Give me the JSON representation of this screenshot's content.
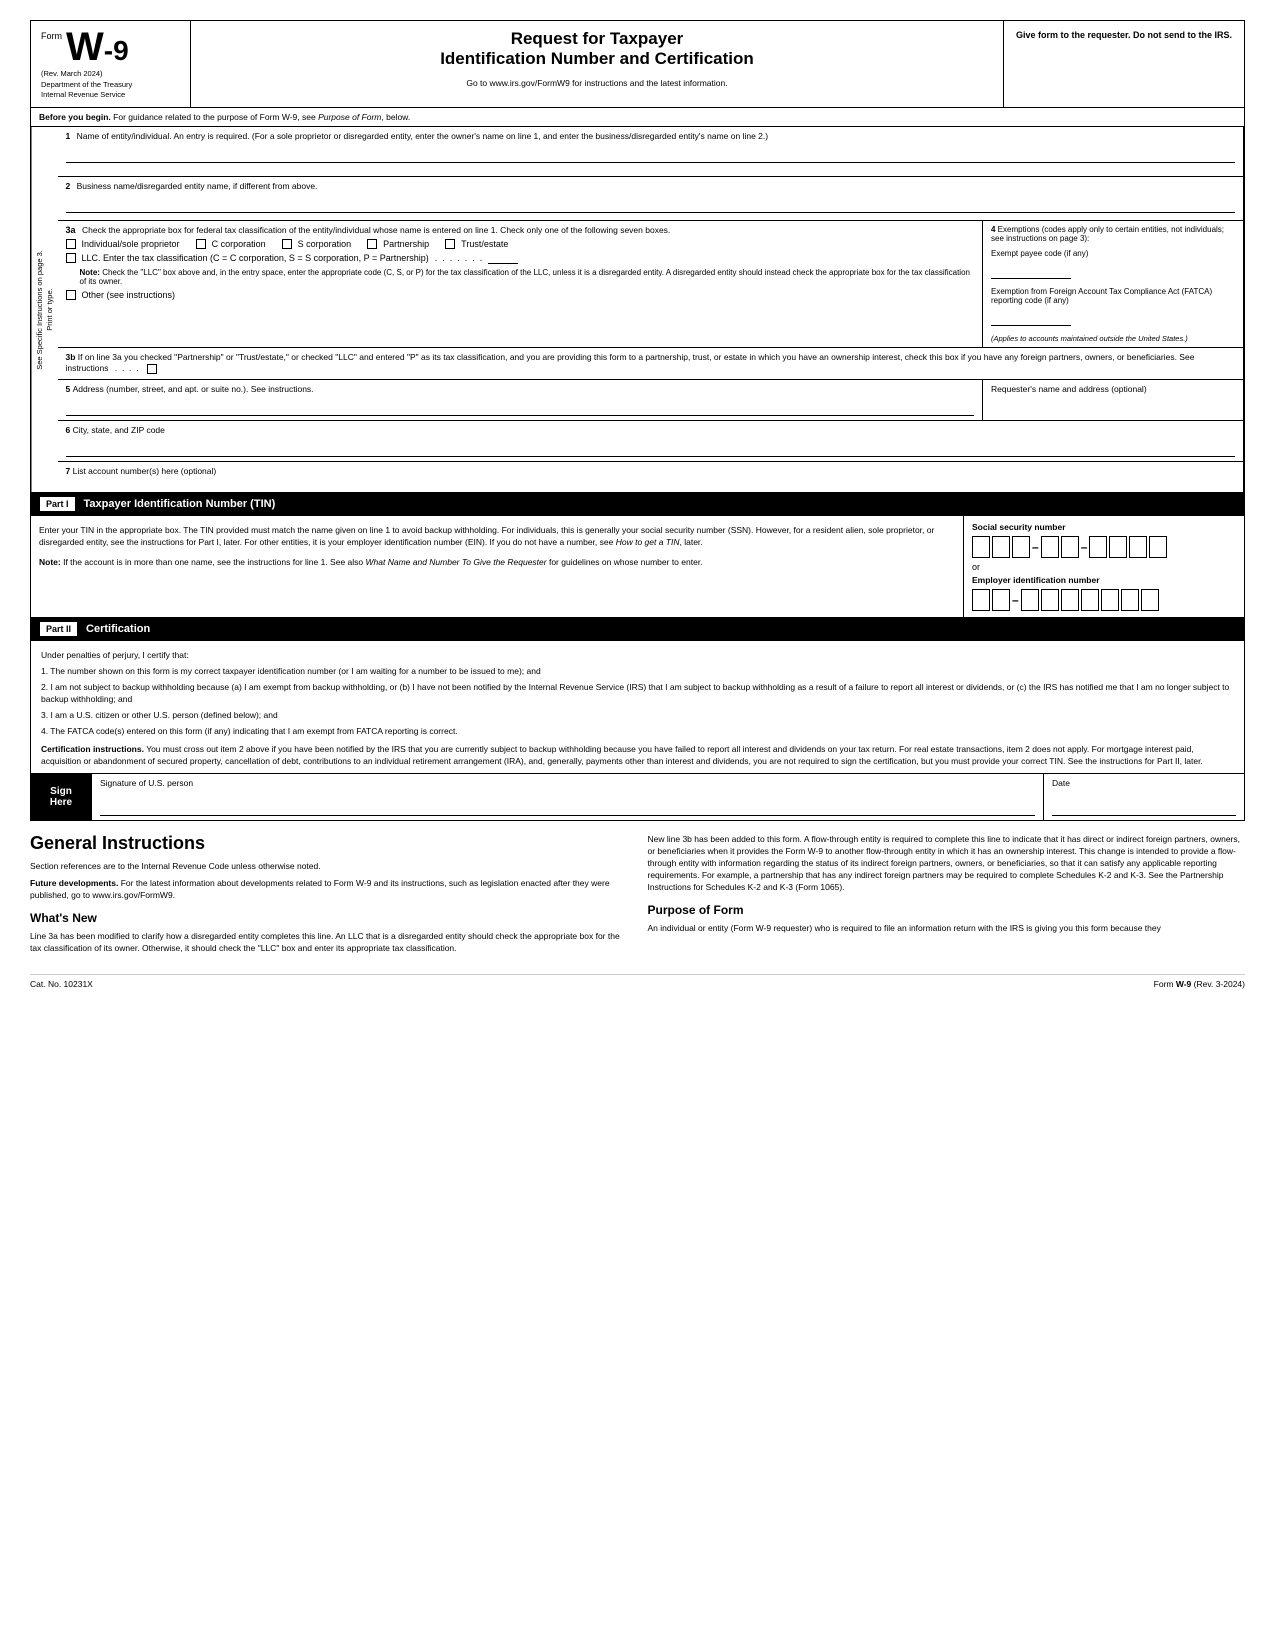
{
  "form": {
    "form_label": "Form",
    "form_w9": "W-9",
    "rev_date": "(Rev. March 2024)",
    "dept": "Department of the Treasury",
    "irs": "Internal Revenue Service",
    "title_line1": "Request for Taxpayer",
    "title_line2": "Identification Number and Certification",
    "subtitle": "Go to www.irs.gov/FormW9 for instructions and the latest information.",
    "give_form": "Give form to the requester. Do not send to the IRS.",
    "before_begin": "Before you begin. For guidance related to the purpose of Form W-9, see Purpose of Form, below.",
    "field1_number": "1",
    "field1_label": "Name of entity/individual. An entry is required. (For a sole proprietor or disregarded entity, enter the owner's name on line 1, and enter the business/disregarded entity's name on line 2.)",
    "field2_number": "2",
    "field2_label": "Business name/disregarded entity name, if different from above.",
    "field3a_number": "3a",
    "field3a_label": "Check the appropriate box for federal tax classification of the entity/individual whose name is entered on line 1. Check only one of the following seven boxes.",
    "cb_individual": "Individual/sole proprietor",
    "cb_ccorp": "C corporation",
    "cb_scorp": "S corporation",
    "cb_partnership": "Partnership",
    "cb_trust": "Trust/estate",
    "llc_label": "LLC. Enter the tax classification (C = C corporation, S = S corporation, P = Partnership)",
    "note_label": "Note:",
    "note_text": "Check the \"LLC\" box above and, in the entry space, enter the appropriate code (C, S, or P) for the tax classification of the LLC, unless it is a disregarded entity. A disregarded entity should instead check the appropriate box for the tax classification of its owner.",
    "cb_other": "Other (see instructions)",
    "field3b_number": "3b",
    "field3b_text": "If on line 3a you checked \"Partnership\" or \"Trust/estate,\" or checked \"LLC\" and entered \"P\" as its tax classification, and you are providing this form to a partnership, trust, or estate in which you have an ownership interest, check this box if you have any foreign partners, owners, or beneficiaries. See instructions",
    "field4_number": "4",
    "field4_label": "Exemptions (codes apply only to certain entities, not individuals; see instructions on page 3):",
    "exempt_payee": "Exempt payee code (if any)",
    "fatca_label": "Exemption from Foreign Account Tax Compliance Act (FATCA) reporting code (if any)",
    "applies_text": "(Applies to accounts maintained outside the United States.)",
    "field5_number": "5",
    "field5_label": "Address (number, street, and apt. or suite no.). See instructions.",
    "requester_label": "Requester's name and address (optional)",
    "field6_number": "6",
    "field6_label": "City, state, and ZIP code",
    "field7_number": "7",
    "field7_label": "List account number(s) here (optional)",
    "side_label_top": "See Specific Instructions on page 3.",
    "side_label_bottom": "Print or type.",
    "part1_label": "Part I",
    "part1_title": "Taxpayer Identification Number (TIN)",
    "tin_instructions": "Enter your TIN in the appropriate box. The TIN provided must match the name given on line 1 to avoid backup withholding. For individuals, this is generally your social security number (SSN). However, for a resident alien, sole proprietor, or disregarded entity, see the instructions for Part I, later. For other entities, it is your employer identification number (EIN). If you do not have a number, see How to get a TIN, later.",
    "tin_note": "Note: If the account is in more than one name, see the instructions for line 1. See also What Name and Number To Give the Requester for guidelines on whose number to enter.",
    "ssn_label": "Social security number",
    "or_text": "or",
    "ein_label": "Employer identification number",
    "part2_label": "Part II",
    "part2_title": "Certification",
    "cert_intro": "Under penalties of perjury, I certify that:",
    "cert_1": "1. The number shown on this form is my correct taxpayer identification number (or I am waiting for a number to be issued to me); and",
    "cert_2": "2. I am not subject to backup withholding because (a) I am exempt from backup withholding, or (b) I have not been notified by the Internal Revenue Service (IRS) that I am subject to backup withholding as a result of a failure to report all interest or dividends, or (c) the IRS has notified me that I am no longer subject to backup withholding; and",
    "cert_3": "3. I am a U.S. citizen or other U.S. person (defined below); and",
    "cert_4": "4. The FATCA code(s) entered on this form (if any) indicating that I am exempt from FATCA reporting is correct.",
    "cert_instructions_label": "Certification instructions.",
    "cert_instructions": "You must cross out item 2 above if you have been notified by the IRS that you are currently subject to backup withholding because you have failed to report all interest and dividends on your tax return. For real estate transactions, item 2 does not apply. For mortgage interest paid, acquisition or abandonment of secured property, cancellation of debt, contributions to an individual retirement arrangement (IRA), and, generally, payments other than interest and dividends, you are not required to sign the certification, but you must provide your correct TIN. See the instructions for Part II, later.",
    "sign_label_line1": "Sign",
    "sign_label_line2": "Here",
    "sign_sig_label": "Signature of U.S. person",
    "sign_date_label": "Date",
    "gi_title": "General Instructions",
    "gi_section_refs": "Section references are to the Internal Revenue Code unless otherwise noted.",
    "gi_future_title": "Future developments.",
    "gi_future": "For the latest information about developments related to Form W-9 and its instructions, such as legislation enacted after they were published, go to www.irs.gov/FormW9.",
    "gi_whatsnew_title": "What's New",
    "gi_whatsnew": "Line 3a has been modified to clarify how a disregarded entity completes this line. An LLC that is a disregarded entity should check the appropriate box for the tax classification of its owner. Otherwise, it should check the \"LLC\" box and enter its appropriate tax classification.",
    "gi_right_text": "New line 3b has been added to this form. A flow-through entity is required to complete this line to indicate that it has direct or indirect foreign partners, owners, or beneficiaries when it provides the Form W-9 to another flow-through entity in which it has an ownership interest. This change is intended to provide a flow-through entity with information regarding the status of its indirect foreign partners, owners, or beneficiaries, so that it can satisfy any applicable reporting requirements. For example, a partnership that has any indirect foreign partners may be required to complete Schedules K-2 and K-3. See the Partnership Instructions for Schedules K-2 and K-3 (Form 1065).",
    "gi_purpose_title": "Purpose of Form",
    "gi_purpose": "An individual or entity (Form W-9 requester) who is required to file an information return with the IRS is giving you this form because they",
    "footer_cat": "Cat. No. 10231X",
    "footer_form": "Form W-9 (Rev. 3-2024)"
  }
}
